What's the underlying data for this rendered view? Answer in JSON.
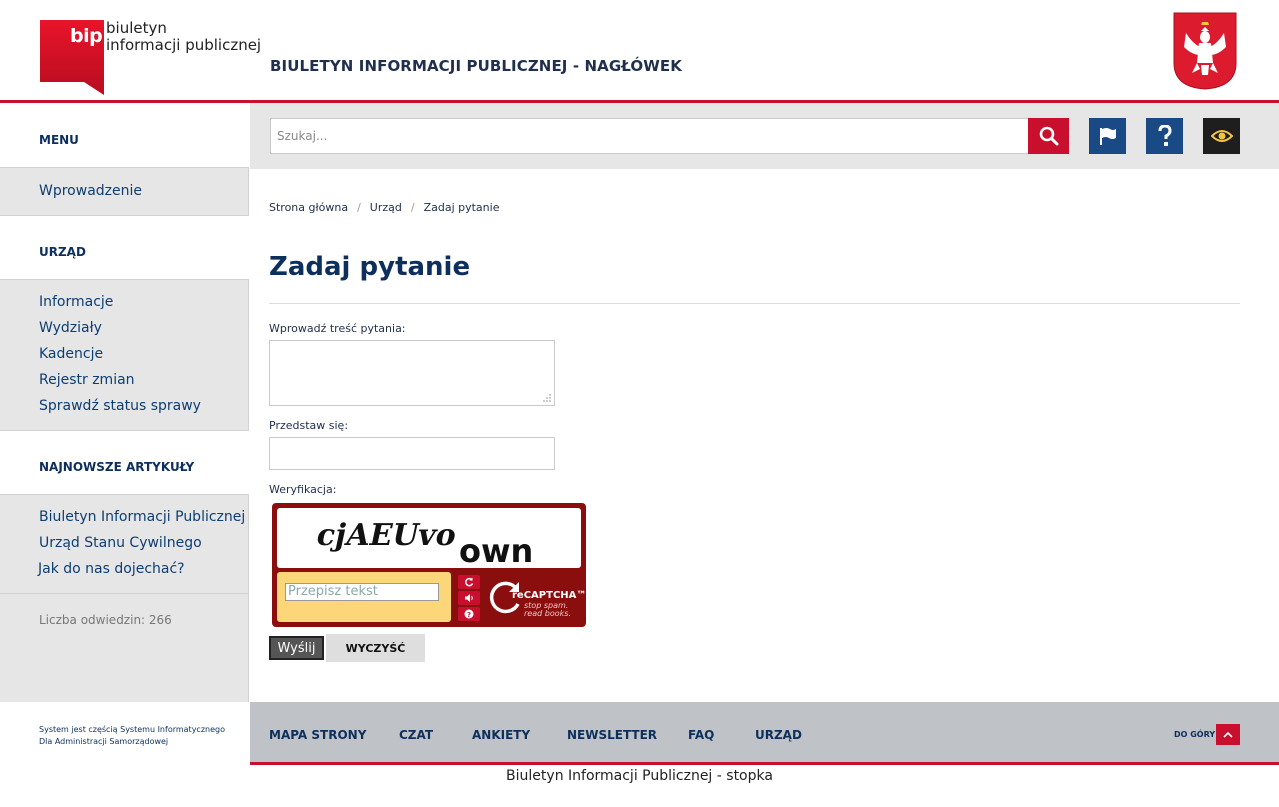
{
  "header": {
    "logo_mark": "bip",
    "logo_line1": "biuletyn",
    "logo_line2": "informacji publicznej",
    "title": "BIULETYN INFORMACJI PUBLICZNEJ - NAGŁÓWEK"
  },
  "search": {
    "placeholder": "Szukaj..."
  },
  "sidebar": {
    "menu_heading": "MENU",
    "menu_items": [
      "Wprowadzenie"
    ],
    "urzad_heading": "URZĄD",
    "urzad_items": [
      "Informacje",
      "Wydziały",
      "Kadencje",
      "Rejestr zmian",
      "Sprawdź status sprawy"
    ],
    "articles_heading": "NAJNOWSZE ARTYKUŁY",
    "articles_items": [
      "Biuletyn Informacji Publicznej",
      "Urząd Stanu Cywilnego",
      "Jak do nas dojechać?"
    ],
    "visits": "Liczba odwiedzin: 266"
  },
  "breadcrumb": [
    "Strona główna",
    "Urząd",
    "Zadaj pytanie"
  ],
  "main": {
    "title": "Zadaj pytanie",
    "question_label": "Wprowadź treść pytania:",
    "name_label": "Przedstaw się:",
    "verify_label": "Weryfikacja:"
  },
  "captcha": {
    "word1": "cjAEUvo",
    "word2": "own",
    "placeholder": "Przepisz tekst",
    "brand": "reCAPTCHA™",
    "tagline1": "stop spam.",
    "tagline2": "read books."
  },
  "buttons": {
    "send": "Wyślij",
    "clear": "WYCZYŚĆ"
  },
  "footer": {
    "info_line1": "System jest częścią Systemu Informatycznego",
    "info_line2": "Dla Administracji Samorządowej",
    "nav": [
      "MAPA STRONY",
      "CZAT",
      "ANKIETY",
      "NEWSLETTER",
      "FAQ",
      "URZĄD"
    ],
    "to_top": "DO GÓRY",
    "bottom_text": "Biuletyn Informacji Publicznej - stopka"
  },
  "colors": {
    "accent_red": "#c8102e",
    "navy": "#0d2f5e",
    "blue_button": "#1a4a86"
  },
  "icons": [
    "search-icon",
    "flag-icon",
    "help-icon",
    "eye-icon",
    "refresh-icon",
    "audio-icon",
    "help-small-icon",
    "chevron-up-icon",
    "emblem-icon"
  ]
}
